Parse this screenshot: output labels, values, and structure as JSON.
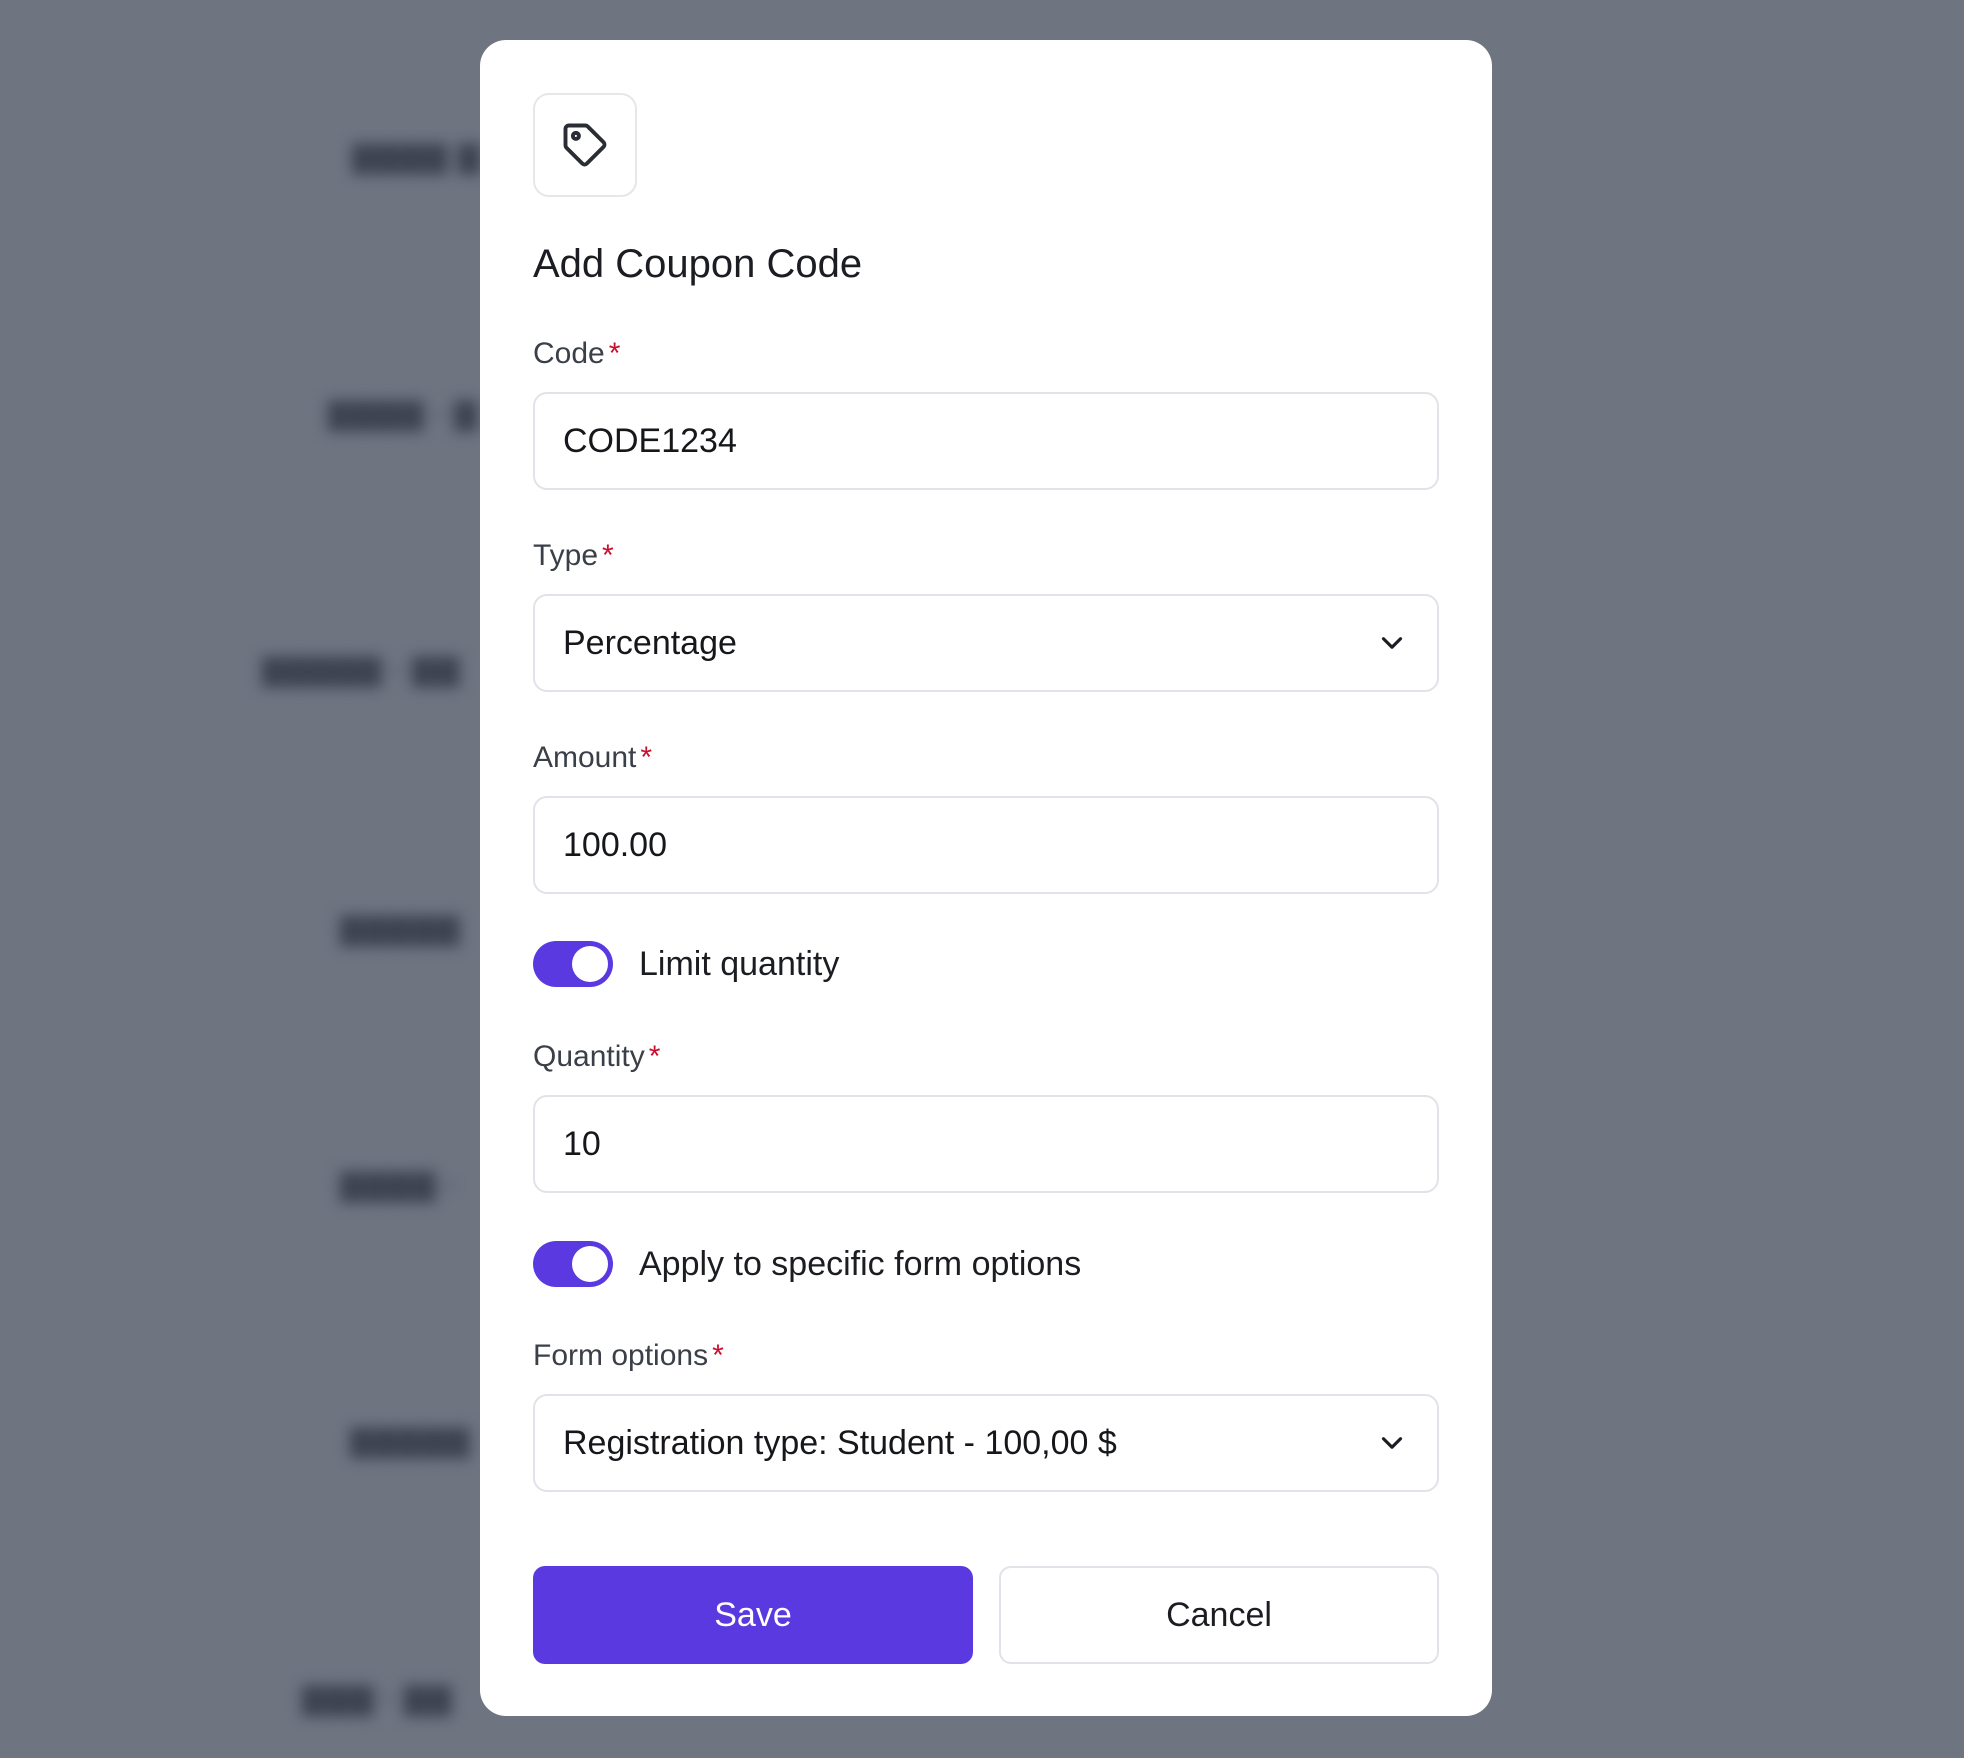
{
  "modal": {
    "title": "Add Coupon Code",
    "icon": "tag-icon"
  },
  "fields": {
    "code": {
      "label": "Code",
      "required_mark": "*",
      "value": "CODE1234"
    },
    "type": {
      "label": "Type",
      "required_mark": "*",
      "value": "Percentage"
    },
    "amount": {
      "label": "Amount",
      "required_mark": "*",
      "value": "100.00"
    },
    "quantity": {
      "label": "Quantity",
      "required_mark": "*",
      "value": "10"
    },
    "form_options": {
      "label": "Form options",
      "required_mark": "*",
      "value": "Registration type: Student - 100,00 $"
    }
  },
  "toggles": {
    "limit_quantity": {
      "label": "Limit quantity",
      "on": true
    },
    "apply_specific": {
      "label": "Apply to specific form options",
      "on": true
    }
  },
  "buttons": {
    "save": "Save",
    "cancel": "Cancel"
  },
  "colors": {
    "accent": "#5a3ae0",
    "required": "#c8102e",
    "overlay": "#6e7480"
  }
}
